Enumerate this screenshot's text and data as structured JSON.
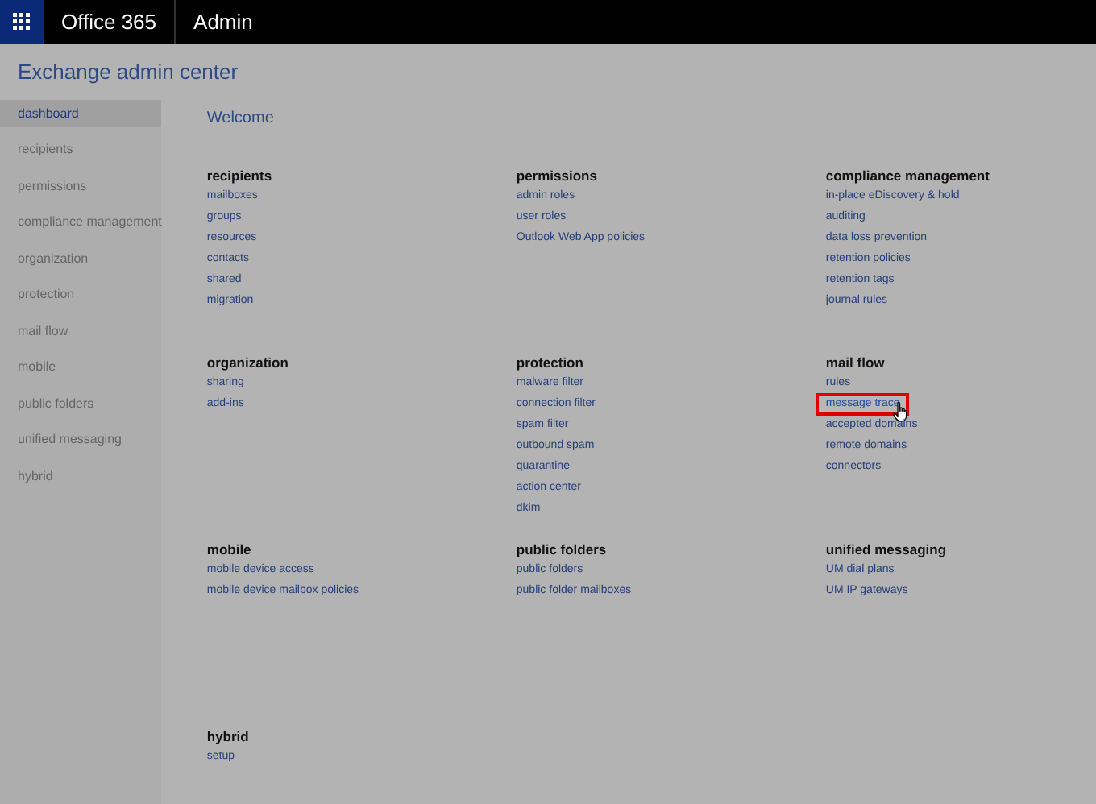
{
  "top_bar": {
    "product": "Office 365",
    "section": "Admin"
  },
  "title": "Exchange admin center",
  "sidebar": {
    "items": [
      {
        "label": "dashboard",
        "selected": true
      },
      {
        "label": "recipients",
        "selected": false
      },
      {
        "label": "permissions",
        "selected": false
      },
      {
        "label": "compliance management",
        "selected": false
      },
      {
        "label": "organization",
        "selected": false
      },
      {
        "label": "protection",
        "selected": false
      },
      {
        "label": "mail flow",
        "selected": false
      },
      {
        "label": "mobile",
        "selected": false
      },
      {
        "label": "public folders",
        "selected": false
      },
      {
        "label": "unified messaging",
        "selected": false
      },
      {
        "label": "hybrid",
        "selected": false
      }
    ]
  },
  "heading": "Welcome",
  "sections": [
    {
      "title": "recipients",
      "links": [
        {
          "label": "mailboxes",
          "highlighted": false
        },
        {
          "label": "groups",
          "highlighted": false
        },
        {
          "label": "resources",
          "highlighted": false
        },
        {
          "label": "contacts",
          "highlighted": false
        },
        {
          "label": "shared",
          "highlighted": false
        },
        {
          "label": "migration",
          "highlighted": false
        }
      ]
    },
    {
      "title": "permissions",
      "links": [
        {
          "label": "admin roles",
          "highlighted": false
        },
        {
          "label": "user roles",
          "highlighted": false
        },
        {
          "label": "Outlook Web App policies",
          "highlighted": false
        }
      ]
    },
    {
      "title": "compliance management",
      "links": [
        {
          "label": "in-place eDiscovery & hold",
          "highlighted": false
        },
        {
          "label": "auditing",
          "highlighted": false
        },
        {
          "label": "data loss prevention",
          "highlighted": false
        },
        {
          "label": "retention policies",
          "highlighted": false
        },
        {
          "label": "retention tags",
          "highlighted": false
        },
        {
          "label": "journal rules",
          "highlighted": false
        }
      ]
    },
    {
      "title": "organization",
      "links": [
        {
          "label": "sharing",
          "highlighted": false
        },
        {
          "label": "add-ins",
          "highlighted": false
        }
      ]
    },
    {
      "title": "protection",
      "links": [
        {
          "label": "malware filter",
          "highlighted": false
        },
        {
          "label": "connection filter",
          "highlighted": false
        },
        {
          "label": "spam filter",
          "highlighted": false
        },
        {
          "label": "outbound spam",
          "highlighted": false
        },
        {
          "label": "quarantine",
          "highlighted": false
        },
        {
          "label": "action center",
          "highlighted": false
        },
        {
          "label": "dkim",
          "highlighted": false
        }
      ]
    },
    {
      "title": "mail flow",
      "links": [
        {
          "label": "rules",
          "highlighted": false
        },
        {
          "label": "message trace",
          "highlighted": true
        },
        {
          "label": "accepted domains",
          "highlighted": false
        },
        {
          "label": "remote domains",
          "highlighted": false
        },
        {
          "label": "connectors",
          "highlighted": false
        }
      ]
    },
    {
      "title": "mobile",
      "links": [
        {
          "label": "mobile device access",
          "highlighted": false
        },
        {
          "label": "mobile device mailbox policies",
          "highlighted": false
        }
      ]
    },
    {
      "title": "public folders",
      "links": [
        {
          "label": "public folders",
          "highlighted": false
        },
        {
          "label": "public folder mailboxes",
          "highlighted": false
        }
      ]
    },
    {
      "title": "unified messaging",
      "links": [
        {
          "label": "UM dial plans",
          "highlighted": false
        },
        {
          "label": "UM IP gateways",
          "highlighted": false
        }
      ]
    },
    {
      "title": "hybrid",
      "links": [
        {
          "label": "setup",
          "highlighted": false
        }
      ]
    }
  ]
}
